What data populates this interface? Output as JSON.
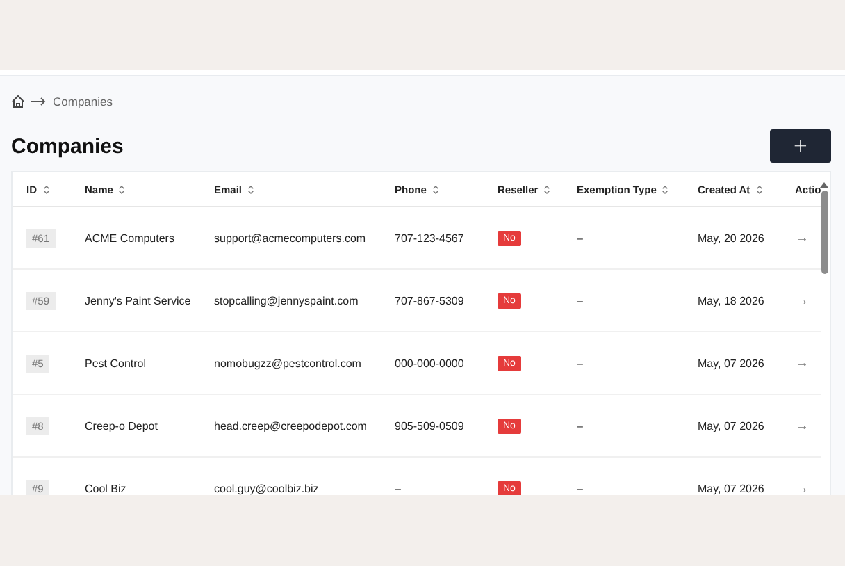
{
  "breadcrumb": {
    "current": "Companies"
  },
  "page_title": "Companies",
  "add_button": {
    "label": "+"
  },
  "table": {
    "columns": [
      "ID",
      "Name",
      "Email",
      "Phone",
      "Reseller",
      "Exemption Type",
      "Created At",
      "Actio"
    ],
    "rows": [
      {
        "id": "#61",
        "name": "ACME Computers",
        "email": "support@acmecomputers.com",
        "phone": "707-123-4567",
        "reseller": "No",
        "exemption_type": "–",
        "created_at": "May, 20 2026",
        "action": "→"
      },
      {
        "id": "#59",
        "name": "Jenny's Paint Service",
        "email": "stopcalling@jennyspaint.com",
        "phone": "707-867-5309",
        "reseller": "No",
        "exemption_type": "–",
        "created_at": "May, 18 2026",
        "action": "→"
      },
      {
        "id": "#5",
        "name": "Pest Control",
        "email": "nomobugzz@pestcontrol.com",
        "phone": "000-000-0000",
        "reseller": "No",
        "exemption_type": "–",
        "created_at": "May, 07 2026",
        "action": "→"
      },
      {
        "id": "#8",
        "name": "Creep-o Depot",
        "email": "head.creep@creepodepot.com",
        "phone": "905-509-0509",
        "reseller": "No",
        "exemption_type": "–",
        "created_at": "May, 07 2026",
        "action": "→"
      },
      {
        "id": "#9",
        "name": "Cool Biz",
        "email": "cool.guy@coolbiz.biz",
        "phone": "–",
        "reseller": "No",
        "exemption_type": "–",
        "created_at": "May, 07 2026",
        "action": "→"
      }
    ]
  }
}
